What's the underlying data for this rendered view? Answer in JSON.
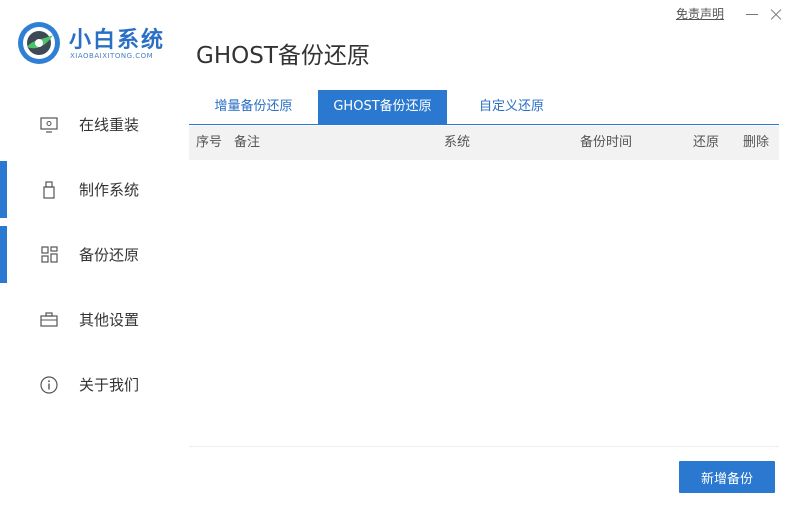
{
  "app": {
    "logo_title": "小白系统",
    "logo_subtitle": "XIAOBAIXITONG.COM",
    "brand_color": "#2a78d0"
  },
  "window": {
    "disclaimer": "免责声明",
    "minimize_icon": "minimize-icon",
    "close_icon": "close-icon"
  },
  "page": {
    "title": "GHOST备份还原"
  },
  "sidebar": {
    "items": [
      {
        "label": "在线重装",
        "icon": "monitor-icon",
        "active": false
      },
      {
        "label": "制作系统",
        "icon": "usb-drive-icon",
        "active": true
      },
      {
        "label": "备份还原",
        "icon": "grid-icon",
        "active": true
      },
      {
        "label": "其他设置",
        "icon": "briefcase-icon",
        "active": false
      },
      {
        "label": "关于我们",
        "icon": "info-icon",
        "active": false
      }
    ]
  },
  "tabs": [
    {
      "label": "增量备份还原",
      "active": false
    },
    {
      "label": "GHOST备份还原",
      "active": true
    },
    {
      "label": "自定义还原",
      "active": false
    }
  ],
  "table": {
    "columns": [
      "序号",
      "备注",
      "系统",
      "备份时间",
      "还原",
      "删除"
    ],
    "rows": []
  },
  "actions": {
    "add_backup": "新增备份"
  }
}
